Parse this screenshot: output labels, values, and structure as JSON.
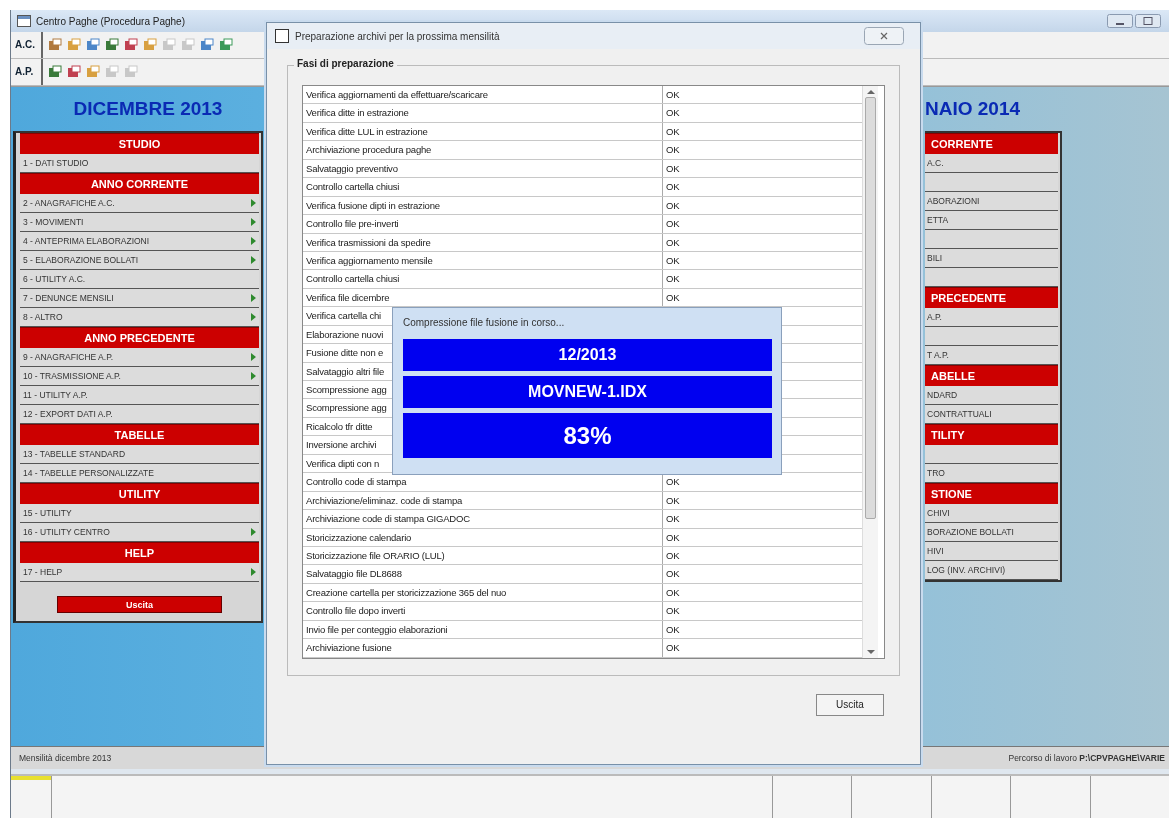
{
  "window": {
    "title": "Centro Paghe (Procedura Paghe)"
  },
  "toolbar_rows": [
    {
      "label": "A.C."
    },
    {
      "label": "A.P."
    }
  ],
  "left_panel": {
    "title": "DICEMBRE 2013",
    "sections": [
      {
        "title": "STUDIO",
        "items": [
          {
            "label": "1 - DATI STUDIO",
            "submenu": false
          }
        ]
      },
      {
        "title": "ANNO CORRENTE",
        "items": [
          {
            "label": "2 - ANAGRAFICHE A.C.",
            "submenu": true
          },
          {
            "label": "3 - MOVIMENTI",
            "submenu": true
          },
          {
            "label": "4 - ANTEPRIMA ELABORAZIONI",
            "submenu": true
          },
          {
            "label": "5 - ELABORAZIONE BOLLATI",
            "submenu": true
          },
          {
            "label": "6 - UTILITY A.C.",
            "submenu": false
          },
          {
            "label": "7 - DENUNCE MENSILI",
            "submenu": true
          },
          {
            "label": "8 - ALTRO",
            "submenu": true
          }
        ]
      },
      {
        "title": "ANNO PRECEDENTE",
        "items": [
          {
            "label": "9 - ANAGRAFICHE A.P.",
            "submenu": true
          },
          {
            "label": "10 - TRASMISSIONE A.P.",
            "submenu": true
          },
          {
            "label": "11 - UTILITY A.P.",
            "submenu": false
          },
          {
            "label": "12 - EXPORT DATI A.P.",
            "submenu": false
          }
        ]
      },
      {
        "title": "TABELLE",
        "items": [
          {
            "label": "13 - TABELLE STANDARD",
            "submenu": false
          },
          {
            "label": "14 - TABELLE PERSONALIZZATE",
            "submenu": false
          }
        ]
      },
      {
        "title": "UTILITY",
        "items": [
          {
            "label": "15 - UTILITY",
            "submenu": false
          },
          {
            "label": "16 - UTILITY CENTRO",
            "submenu": true
          }
        ]
      },
      {
        "title": "HELP",
        "items": [
          {
            "label": "17 - HELP",
            "submenu": true
          }
        ]
      }
    ],
    "exit_button": "Uscita"
  },
  "right_panel": {
    "title": "NAIO 2014",
    "sections": [
      {
        "title": "CORRENTE",
        "items": [
          {
            "kind": "item",
            "label": "A.C."
          },
          {
            "kind": "blank"
          },
          {
            "kind": "item",
            "label": "ABORAZIONI"
          },
          {
            "kind": "item",
            "label": "ETTA"
          },
          {
            "kind": "blank"
          },
          {
            "kind": "item",
            "label": "BILI"
          },
          {
            "kind": "blank"
          }
        ]
      },
      {
        "title": "PRECEDENTE",
        "items": [
          {
            "kind": "item",
            "label": "A.P."
          },
          {
            "kind": "blank"
          },
          {
            "kind": "item",
            "label": "T A.P."
          }
        ]
      },
      {
        "title": "ABELLE",
        "items": [
          {
            "kind": "item",
            "label": "NDARD"
          },
          {
            "kind": "item",
            "label": "CONTRATTUALI"
          }
        ]
      },
      {
        "title": "TILITY",
        "items": [
          {
            "kind": "blank"
          },
          {
            "kind": "item",
            "label": "TRO"
          }
        ]
      },
      {
        "title": "STIONE",
        "items": [
          {
            "kind": "item",
            "label": "CHIVI"
          },
          {
            "kind": "item",
            "label": "BORAZIONE BOLLATI"
          },
          {
            "kind": "item",
            "label": "HIVI"
          },
          {
            "kind": "item",
            "label": "LOG (INV. ARCHIVI)"
          }
        ]
      }
    ]
  },
  "dialog": {
    "title": "Preparazione archivi per la prossima mensilità",
    "group": "Fasi di preparazione",
    "rows": [
      {
        "step": "Verifica aggiornamenti da effettuare/scaricare",
        "status": "OK"
      },
      {
        "step": "Verifica ditte in estrazione",
        "status": "OK"
      },
      {
        "step": "Verifica ditte LUL in estrazione",
        "status": "OK"
      },
      {
        "step": "Archiviazione procedura paghe",
        "status": "OK"
      },
      {
        "step": "Salvataggio preventivo",
        "status": "OK"
      },
      {
        "step": "Controllo cartella chiusi",
        "status": "OK"
      },
      {
        "step": "Verifica fusione dipti in estrazione",
        "status": "OK"
      },
      {
        "step": "Controllo file pre-inverti",
        "status": "OK"
      },
      {
        "step": "Verifica trasmissioni da spedire",
        "status": "OK"
      },
      {
        "step": "Verifica aggiornamento mensile",
        "status": "OK"
      },
      {
        "step": "Controllo cartella chiusi",
        "status": "OK"
      },
      {
        "step": "Verifica file dicembre",
        "status": "OK"
      },
      {
        "step": "Verifica cartella chi"
      },
      {
        "step": "Elaborazione nuovi"
      },
      {
        "step": "Fusione ditte non e"
      },
      {
        "step": "Salvataggio altri file"
      },
      {
        "step": "Scompressione agg"
      },
      {
        "step": "Scompressione agg"
      },
      {
        "step": "Ricalcolo tfr ditte"
      },
      {
        "step": "Inversione archivi"
      },
      {
        "step": "Verifica dipti con n"
      },
      {
        "step": "Controllo code di stampa",
        "status": "OK"
      },
      {
        "step": "Archiviazione/eliminaz. code di stampa",
        "status": "OK"
      },
      {
        "step": "Archiviazione code di stampa GIGADOC",
        "status": "OK"
      },
      {
        "step": "Storicizzazione calendario",
        "status": "OK"
      },
      {
        "step": "Storicizzazione file ORARIO (LUL)",
        "status": "OK"
      },
      {
        "step": "Salvataggio file DL8688",
        "status": "OK"
      },
      {
        "step": "Creazione cartella per storicizzazione 365 del nuo",
        "status": "OK"
      },
      {
        "step": "Controllo file dopo inverti",
        "status": "OK"
      },
      {
        "step": "Invio file per conteggio elaborazioni",
        "status": "OK"
      },
      {
        "step": "Archiviazione fusione",
        "status": "OK"
      }
    ],
    "exit_button": "Uscita"
  },
  "progress": {
    "title": "Compressione file fusione in corso...",
    "period": "12/2013",
    "file": "MOVNEW-1.IDX",
    "percent": "83%"
  },
  "status_bar": {
    "left": "Mensilità dicembre 2013",
    "right": "Percorso di lavoro **P:\\CPVPAGHE\\VARIE**"
  }
}
